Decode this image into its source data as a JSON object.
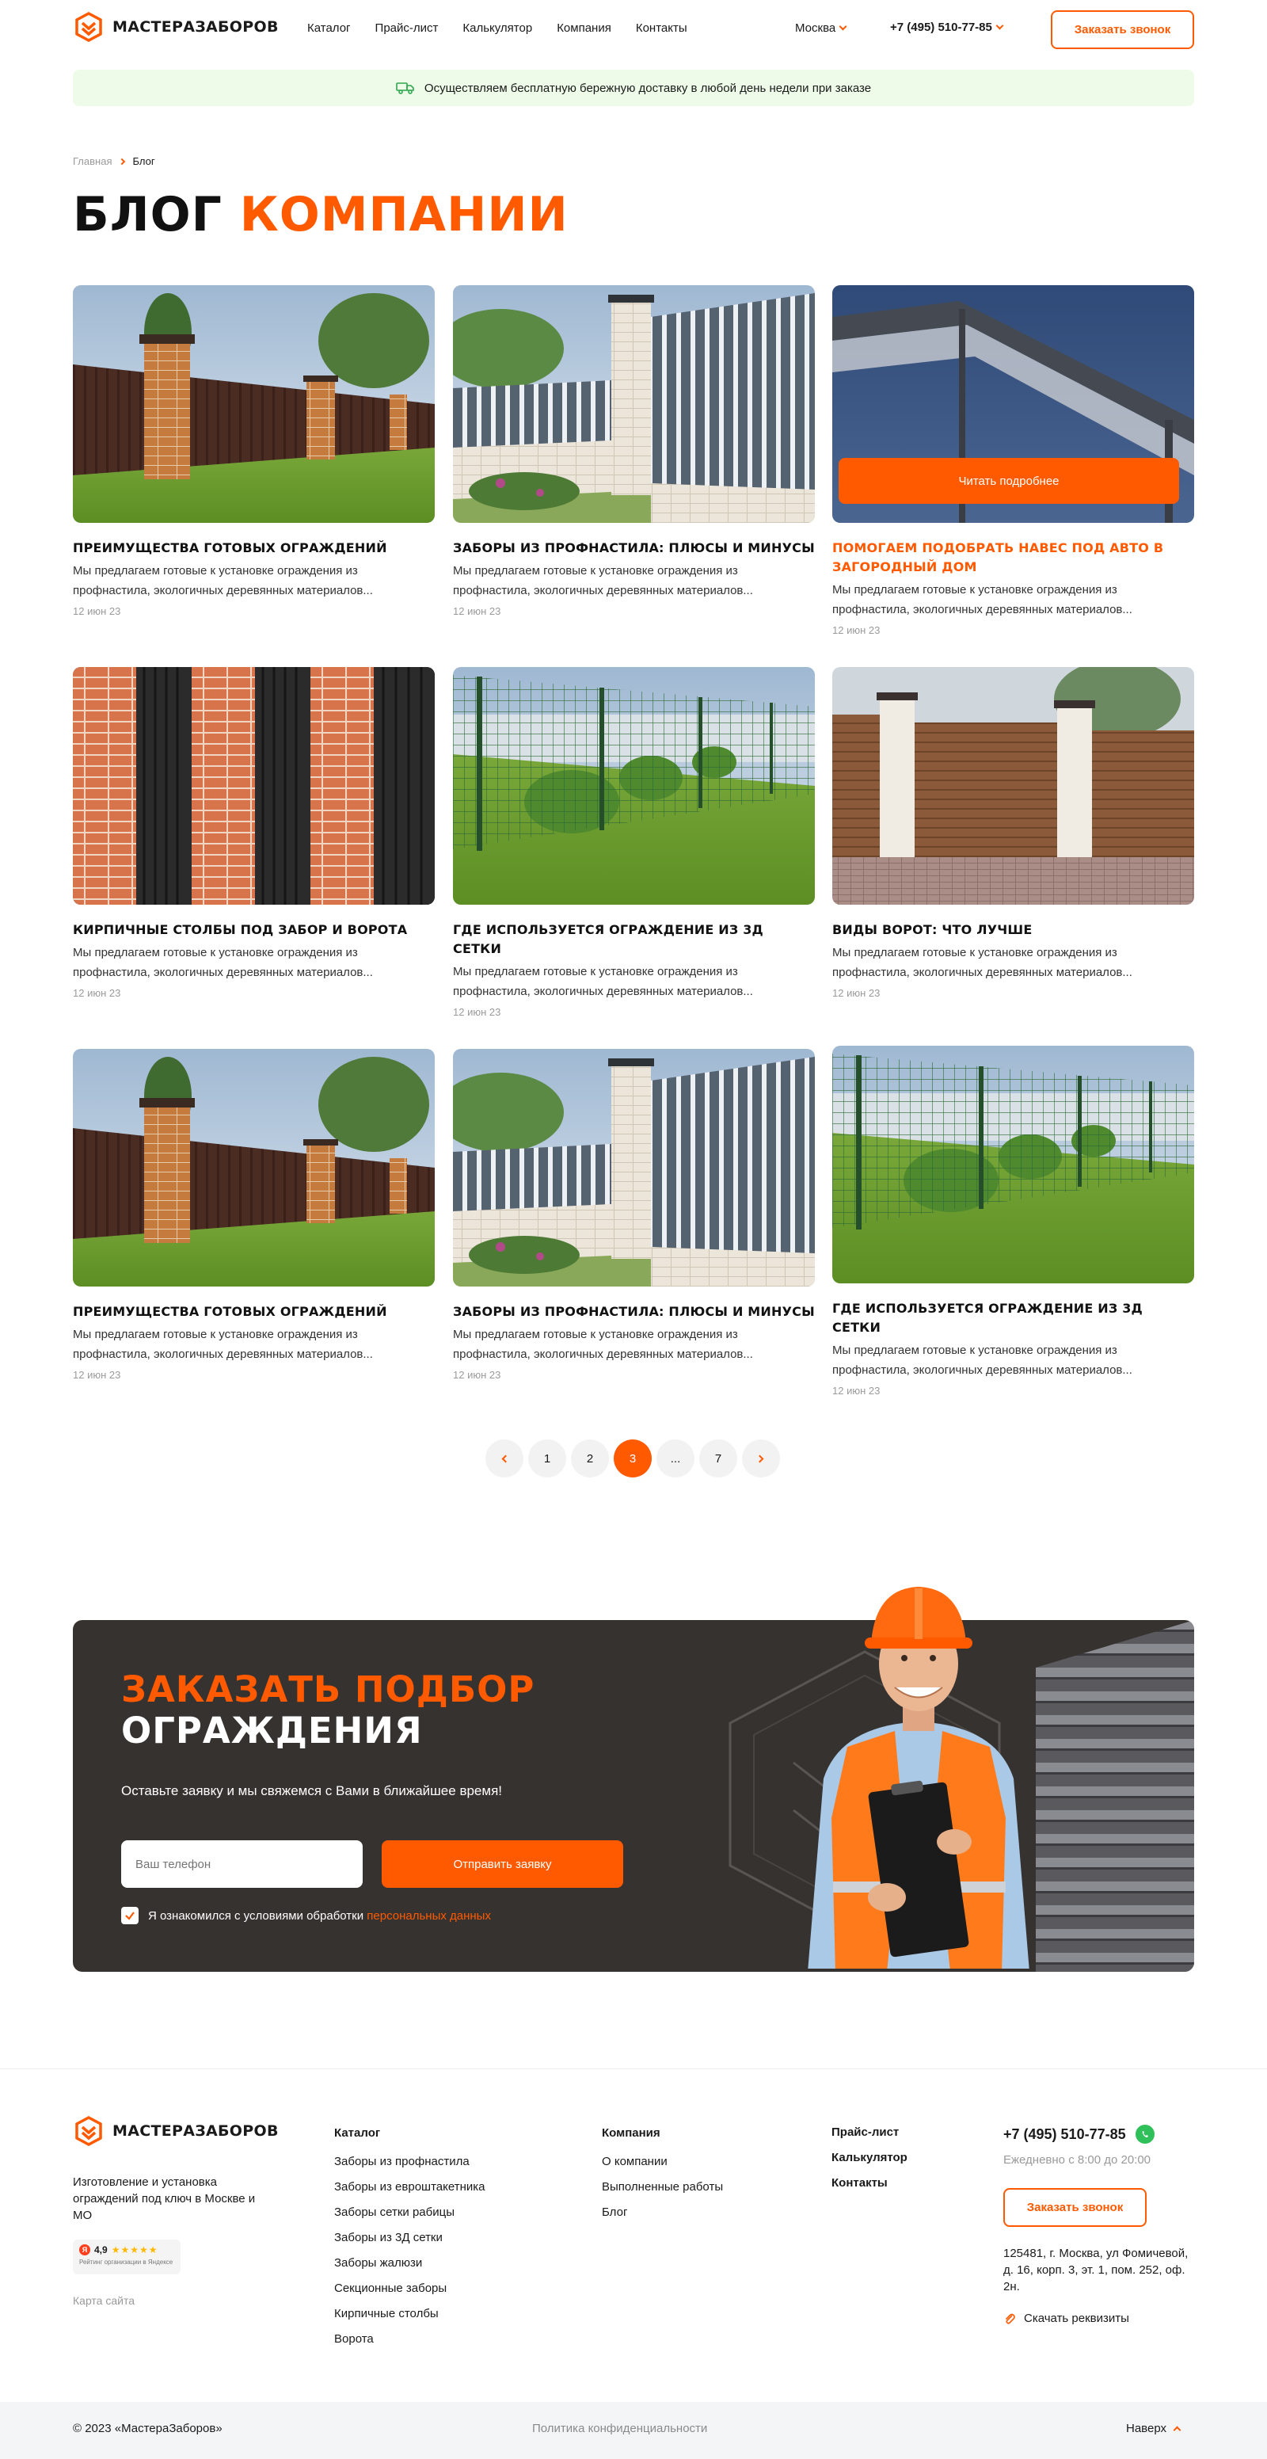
{
  "brand": {
    "name": "МАСТЕРАЗАБОРОВ",
    "accent": "#ff5a00",
    "dark": "#363230"
  },
  "nav": [
    "Каталог",
    "Прайс-лист",
    "Калькулятор",
    "Компания",
    "Контакты"
  ],
  "header": {
    "city": "Москва",
    "phone": "+7 (495) 510-77-85",
    "call_button": "Заказать звонок"
  },
  "banner": {
    "icon": "truck-icon",
    "text": "Осуществляем бесплатную бережную доставку в любой день недели при заказе"
  },
  "breadcrumbs": [
    "Главная",
    "Блог"
  ],
  "page_title": {
    "part1": "БЛОГ",
    "part2": "КОМПАНИИ"
  },
  "posts": [
    {
      "title": "ПРЕИМУЩЕСТВА ГОТОВЫХ ОГРАЖДЕНИЙ",
      "desc": "Мы предлагаем готовые к установке ограждения из профнастила, экологичных деревянных материалов...",
      "date": "12 июн 23"
    },
    {
      "title": "ЗАБОРЫ ИЗ ПРОФНАСТИЛА: ПЛЮСЫ И МИНУСЫ",
      "desc": "Мы предлагаем готовые к установке ограждения из профнастила, экологичных деревянных материалов...",
      "date": "12 июн 23"
    },
    {
      "title": "ПОМОГАЕМ ПОДОБРАТЬ НАВЕС ПОД АВТО В ЗАГОРОДНЫЙ ДОМ",
      "desc": "Мы предлагаем готовые к установке ограждения из профнастила, экологичных деревянных материалов...",
      "date": "12 июн 23",
      "button": "Читать подробнее"
    },
    {
      "title": "КИРПИЧНЫЕ СТОЛБЫ ПОД ЗАБОР И ВОРОТА",
      "desc": "Мы предлагаем готовые к установке ограждения из профнастила, экологичных деревянных материалов...",
      "date": "12 июн 23"
    },
    {
      "title": "ГДЕ ИСПОЛЬЗУЕТСЯ ОГРАЖДЕНИЕ ИЗ 3Д СЕТКИ",
      "desc": "Мы предлагаем готовые к установке ограждения из профнастила, экологичных деревянных материалов...",
      "date": "12 июн 23"
    },
    {
      "title": "ВИДЫ ВОРОТ: ЧТО ЛУЧШЕ",
      "desc": "Мы предлагаем готовые к установке ограждения из профнастила, экологичных деревянных материалов...",
      "date": "12 июн 23"
    },
    {
      "title": "ПРЕИМУЩЕСТВА ГОТОВЫХ ОГРАЖДЕНИЙ",
      "desc": "Мы предлагаем готовые к установке ограждения из профнастила, экологичных деревянных материалов...",
      "date": "12 июн 23"
    },
    {
      "title": "ЗАБОРЫ ИЗ ПРОФНАСТИЛА: ПЛЮСЫ И МИНУСЫ",
      "desc": "Мы предлагаем готовые к установке ограждения из профнастила, экологичных деревянных материалов...",
      "date": "12 июн 23"
    },
    {
      "title": "ГДЕ ИСПОЛЬЗУЕТСЯ ОГРАЖДЕНИЕ ИЗ 3Д СЕТКИ",
      "desc": "Мы предлагаем готовые к установке ограждения из профнастила, экологичных деревянных материалов...",
      "date": "12 июн 23"
    }
  ],
  "pagination": {
    "pages": [
      "1",
      "2",
      "3",
      "...",
      "7"
    ],
    "active": "3"
  },
  "cta": {
    "title_line1": "ЗАКАЗАТЬ ПОДБОР",
    "title_line2": "ОГРАЖДЕНИЯ",
    "subtitle": "Оставьте заявку и мы свяжемся с Вами в ближайшее время!",
    "phone_placeholder": "Ваш телефон",
    "submit": "Отправить заявку",
    "consent_text": "Я ознакомился с условиями обработки",
    "consent_link": "персональных данных"
  },
  "footer": {
    "description": "Изготовление и установка ограждений под ключ в Москве и МО",
    "rating_value": "4,9",
    "rating_caption": "Рейтинг организации в Яндексе",
    "sitemap": "Карта сайта",
    "catalog_title": "Каталог",
    "catalog_items": [
      "Заборы из профнастила",
      "Заборы из евроштакетника",
      "Заборы сетки рабицы",
      "Заборы из 3Д сетки",
      "Заборы жалюзи",
      "Секционные заборы",
      "Кирпичные столбы",
      "Ворота"
    ],
    "company_title": "Компания",
    "company_items": [
      "О компании",
      "Выполненные работы",
      "Блог"
    ],
    "links": [
      "Прайс-лист",
      "Калькулятор",
      "Контакты"
    ],
    "phone": "+7 (495) 510-77-85",
    "hours": "Ежедневно с 8:00 до 20:00",
    "call_button": "Заказать звонок",
    "address": "125481, г. Москва, ул Фомичевой, д. 16, корп. 3, эт. 1, пом. 252, оф. 2н.",
    "download": "Скачать реквизиты"
  },
  "bottom": {
    "copyright": "© 2023 «МастераЗаборов»",
    "policy": "Политика конфиденциальности",
    "up": "Наверх"
  }
}
